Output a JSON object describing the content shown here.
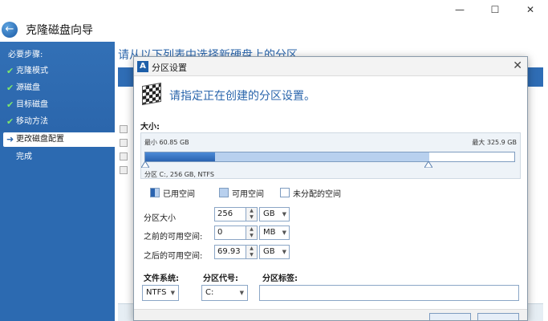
{
  "window": {
    "title": "克隆磁盘向导",
    "back_glyph": "←",
    "controls": {
      "minimize": "—",
      "maximize": "☐",
      "close": "✕"
    }
  },
  "sidebar": {
    "heading": "必要步骤:",
    "steps": [
      {
        "label": "克隆模式",
        "done": true
      },
      {
        "label": "源磁盘",
        "done": true
      },
      {
        "label": "目标磁盘",
        "done": true
      },
      {
        "label": "移动方法",
        "done": true
      },
      {
        "label": "更改磁盘配置",
        "done": false,
        "active": true
      },
      {
        "label": "完成",
        "done": false
      }
    ]
  },
  "content": {
    "heading": "请从以下列表中选择新硬盘上的分区"
  },
  "dialog": {
    "title": "分区设置",
    "logo_letter": "A",
    "close_glyph": "✕",
    "instruction": "请指定正在创建的分区设置。",
    "size_section": "大小:",
    "disk": {
      "min_label": "最小 60.85 GB",
      "max_label": "最大 325.9 GB",
      "partition_label": "分区 C:, 256 GB, NTFS",
      "used_fraction": 0.19,
      "allocated_fraction": 0.77
    },
    "legend": [
      {
        "label": "已用空间",
        "color": "#2a63b0"
      },
      {
        "label": "可用空间",
        "color": "#b8d0ee"
      },
      {
        "label": "未分配的空间",
        "color": "#ffffff"
      }
    ],
    "fields": [
      {
        "label": "分区大小",
        "value": "256",
        "unit": "GB"
      },
      {
        "label": "之前的可用空间:",
        "value": "0",
        "unit": "MB"
      },
      {
        "label": "之后的可用空间:",
        "value": "69.93",
        "unit": "GB"
      }
    ],
    "bottom": {
      "fs_label": "文件系统:",
      "fs_value": "NTFS",
      "letter_label": "分区代号:",
      "letter_value": "C:",
      "volume_label": "分区标签:",
      "volume_value": ""
    },
    "spin_up": "▲",
    "spin_down": "▼",
    "dropdown_arrow": "▼"
  },
  "colors": {
    "accent": "#2b66ac",
    "sidebar": "#2c6ab1",
    "check": "#7ee86b"
  }
}
